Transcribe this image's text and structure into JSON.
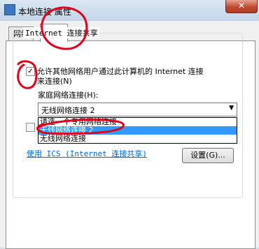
{
  "window": {
    "title": "本地连接 属性",
    "close_glyph": "✕"
  },
  "tabs": [
    {
      "label": "网络"
    },
    {
      "label": "共享"
    }
  ],
  "group": {
    "legend": "Internet 连接共享"
  },
  "allow_sharing": {
    "checked": true,
    "checkmark": "✓",
    "label_line1": "允许其他网络用户通过此计算机的 Internet 连接",
    "label_line2": "来连接(N)"
  },
  "home_network": {
    "label": "家庭网络连接(H):",
    "selected": "无线网络连接 2",
    "arrow": "▼",
    "options": [
      "请选一个专用网络连接",
      "无线网络连接 2",
      "无线网络连接"
    ]
  },
  "ics_link": "使用 ICS (Internet 连接共享)",
  "settings_button": "设置(G)...",
  "colors": {
    "annotation": "#e0001b",
    "selection": "#3399ff",
    "link": "#0066cc"
  }
}
